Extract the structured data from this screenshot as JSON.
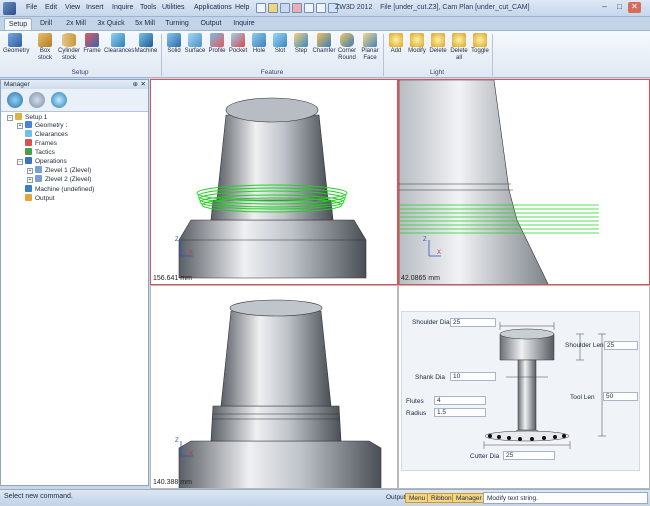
{
  "window": {
    "title": "ZW3D 2012",
    "file": "File [under_cut.Z3],  Cam Plan [under_cut_CAM]"
  },
  "menu": [
    "File",
    "Edit",
    "View",
    "Insert",
    "Inquire",
    "Tools",
    "Utilities",
    "Applications",
    "Help"
  ],
  "tabs": [
    "Setup",
    "Drill",
    "2x Mill",
    "3x Quick",
    "5x Mill",
    "Turning",
    "Output",
    "Inquire"
  ],
  "ribbon": {
    "setup_buttons": [
      "Geometry",
      "Box\nstock",
      "Cylinder\nstock",
      "Frame",
      "Clearances",
      "Machine"
    ],
    "feature_buttons": [
      "Solid",
      "Surface",
      "Profile",
      "Pocket",
      "Hole",
      "Slot",
      "Step",
      "Chamfer",
      "Corner\nRound",
      "Planar\nFace"
    ],
    "light_buttons": [
      "Add",
      "Modify",
      "Delete",
      "Delete\nall",
      "Toggle"
    ],
    "groups": [
      "Setup",
      "Feature",
      "Light"
    ]
  },
  "manager": {
    "title": "Manager",
    "tree": [
      "Setup 1",
      "Geometry :",
      "Clearances",
      "Frames",
      "Tactics",
      "Operations",
      "Zlevel 1 (Zlevel)",
      "Zlevel 2 (Zlevel)",
      "Machine (undefined)",
      "Output"
    ]
  },
  "viewport": {
    "dims": [
      "156.641 mm",
      "42.0865 mm",
      "140.388 mm"
    ],
    "axes": {
      "z": "Z",
      "x": "X"
    }
  },
  "tool": {
    "shoulder_dia_label": "Shoulder Dia",
    "shoulder_dia": "25",
    "shoulder_len_label": "Shoulder Len",
    "shoulder_len": "25",
    "shank_dia_label": "Shank Dia",
    "shank_dia": "10",
    "flutes_label": "Flutes",
    "flutes": "4",
    "radius_label": "Radius",
    "radius": "1.5",
    "tool_len_label": "Tool Len",
    "tool_len": "50",
    "cutter_dia_label": "Cutter Dia",
    "cutter_dia": "25"
  },
  "status": {
    "text": "Select new command.",
    "tabs": [
      "Output",
      "Menu",
      "Ribbon",
      "Manager"
    ],
    "hint": "Modify text string."
  },
  "colors": {
    "accent": "#f6d580",
    "toolpath": "#22d022",
    "selection": "#e05050"
  }
}
